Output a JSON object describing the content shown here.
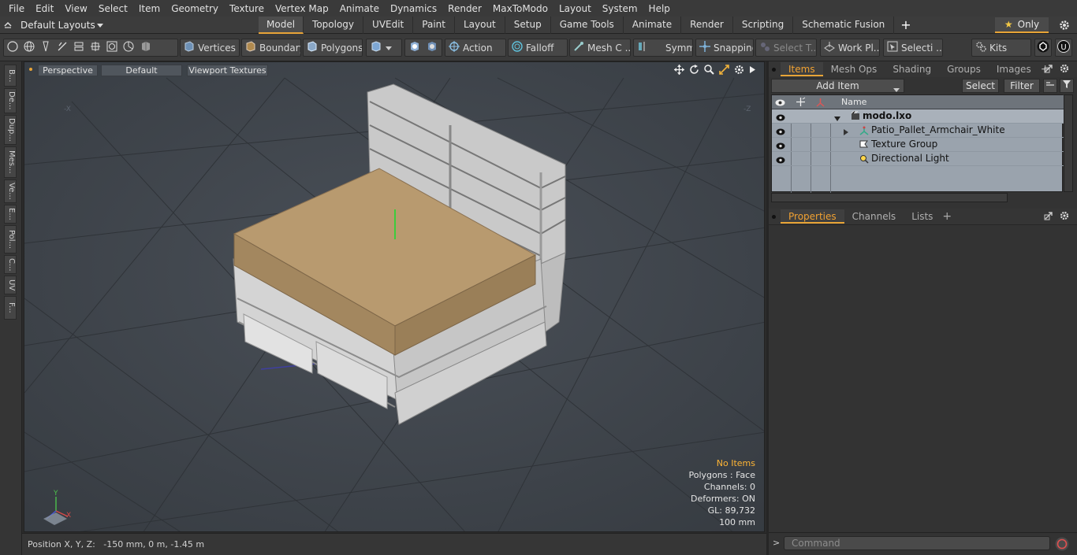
{
  "menu": [
    "File",
    "Edit",
    "View",
    "Select",
    "Item",
    "Geometry",
    "Texture",
    "Vertex Map",
    "Animate",
    "Dynamics",
    "Render",
    "MaxToModo",
    "Layout",
    "System",
    "Help"
  ],
  "layouts_label": "Default Layouts",
  "tabs": [
    "Model",
    "Topology",
    "UVEdit",
    "Paint",
    "Layout",
    "Setup",
    "Game Tools",
    "Animate",
    "Render",
    "Scripting",
    "Schematic Fusion"
  ],
  "active_tab": "Model",
  "only_label": "Only",
  "toolbar": {
    "vertices": "Vertices",
    "boundary": "Boundary",
    "polygons": "Polygons",
    "action": "Action",
    "falloff": "Falloff",
    "mesh": "Mesh C ...",
    "symm": "Symm ...",
    "snapping": "Snapping",
    "select_t": "Select T...",
    "workpl": "Work Pl...",
    "selecti": "Selecti ...",
    "kits": "Kits"
  },
  "left_tabs": [
    "B...",
    "De...",
    "Dup...",
    "Mes...",
    "Ve...",
    "E...",
    "Pol...",
    "C...",
    "UV",
    "F..."
  ],
  "viewport": {
    "view": "Perspective",
    "shading": "Default",
    "textures": "Viewport Textures",
    "stats": {
      "no_items": "No Items",
      "polygons": "Polygons : Face",
      "channels": "Channels: 0",
      "deformers": "Deformers: ON",
      "gl": "GL: 89,732",
      "scale": "100 mm"
    }
  },
  "status": {
    "position": "Position X, Y, Z:   -150 mm, 0 m, -1.45 m"
  },
  "items_panel": {
    "tabs": [
      "Items",
      "Mesh Ops",
      "Shading",
      "Groups",
      "Images"
    ],
    "active": "Items",
    "add_item": "Add Item",
    "select": "Select",
    "filter": "Filter",
    "name_header": "Name",
    "rows": [
      {
        "name": "modo.lxo"
      },
      {
        "name": "Patio_Pallet_Armchair_White"
      },
      {
        "name": "Texture Group"
      },
      {
        "name": "Directional Light"
      }
    ]
  },
  "props_panel": {
    "tabs": [
      "Properties",
      "Channels",
      "Lists"
    ],
    "active": "Properties"
  },
  "command": {
    "placeholder": "Command"
  },
  "colors": {
    "accent": "#e8a437",
    "viewport_bg": "#41474e",
    "list_bg": "#9aa3ad"
  }
}
